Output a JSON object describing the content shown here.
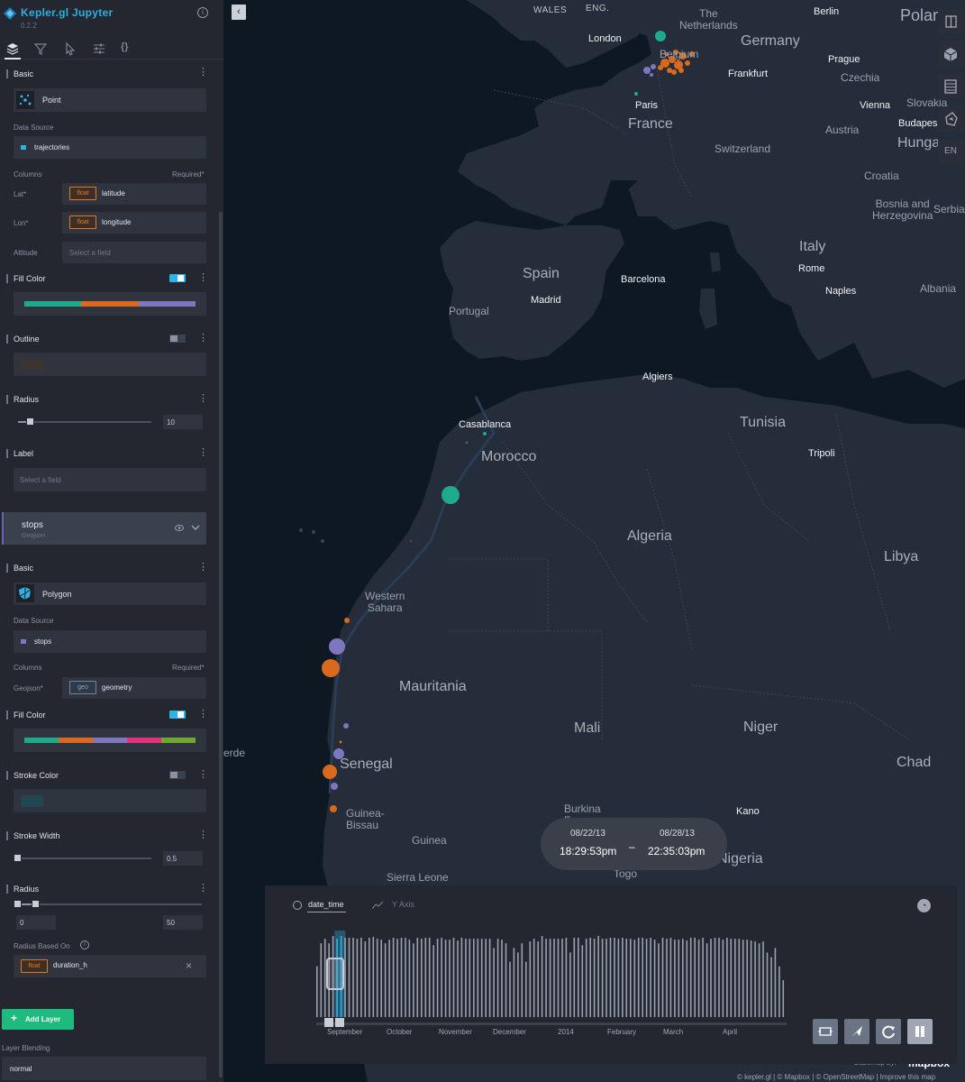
{
  "app": {
    "title": "Kepler.gl Jupyter",
    "version": "0.2.2"
  },
  "sidebar": {
    "tabs": [
      "layers-icon",
      "filter-icon",
      "interaction-icon",
      "settings-icon",
      "code-icon"
    ],
    "layer1": {
      "basic_label": "Basic",
      "type": "Point",
      "data_source_label": "Data Source",
      "data_source": "trajectories",
      "data_source_color": "#2fb3e5",
      "columns_label": "Columns",
      "required_label": "Required*",
      "lat_label": "Lat*",
      "lat_type": "float",
      "lat_field": "latitude",
      "lon_label": "Lon*",
      "lon_type": "float",
      "lon_field": "longitude",
      "alt_label": "Altitude",
      "alt_placeholder": "Select a field",
      "fill_color_label": "Fill Color",
      "fill_palette": [
        "#1fa98d",
        "#d8691f",
        "#7f76bf"
      ],
      "outline_label": "Outline",
      "outline_color": "#3c3430",
      "radius_label": "Radius",
      "radius_value": "10",
      "label_label": "Label",
      "label_placeholder": "Select a field"
    },
    "layer2": {
      "name": "stops",
      "layer_type": "Geojson",
      "basic_label": "Basic",
      "type": "Polygon",
      "data_source_label": "Data Source",
      "data_source": "stops",
      "data_source_color": "#7f76bf",
      "columns_label": "Columns",
      "required_label": "Required*",
      "geojson_label": "Geojson*",
      "geojson_type": "geo",
      "geojson_field": "geometry",
      "fill_color_label": "Fill Color",
      "fill_palette": [
        "#1fa98d",
        "#d8691f",
        "#7f76bf",
        "#e0327a",
        "#6fa731"
      ],
      "stroke_color_label": "Stroke Color",
      "stroke_color": "#20464f",
      "stroke_width_label": "Stroke Width",
      "stroke_width_value": "0.5",
      "radius_label": "Radius",
      "radius_min": "0",
      "radius_max": "50",
      "radius_based_on_label": "Radius Based On",
      "radius_based_type": "float",
      "radius_based_field": "duration_h"
    },
    "add_layer_label": "Add Layer",
    "layer_blending_label": "Layer Blending",
    "layer_blending_value": "normal"
  },
  "map": {
    "labels": {
      "wales": "WALES",
      "eng": "ENG.",
      "the_netherlands": "The\nNetherlands",
      "berlin": "Berlin",
      "poland": "Polan",
      "london": "London",
      "germany": "Germany",
      "belgium": "Belgium",
      "prague": "Prague",
      "frankfurt": "Frankfurt",
      "czechia": "Czechia",
      "paris": "Paris",
      "vienna": "Vienna",
      "slovakia": "Slovakia",
      "france": "France",
      "austria": "Austria",
      "budapest": "Budapes",
      "hungary": "Hunga",
      "switzerland": "Switzerland",
      "croatia": "Croatia",
      "bosnia": "Bosnia and\nHerzegovina",
      "serbia": "Serbia",
      "italy": "Italy",
      "spain": "Spain",
      "barcelona": "Barcelona",
      "rome": "Rome",
      "madrid": "Madrid",
      "naples": "Naples",
      "albania": "Albania",
      "portugal": "Portugal",
      "algiers": "Algiers",
      "casablanca": "Casablanca",
      "tunisia": "Tunisia",
      "tripoli": "Tripoli",
      "morocco": "Morocco",
      "algeria": "Algeria",
      "libya": "Libya",
      "western_sahara": "Western\nSahara",
      "mauritania": "Mauritania",
      "mali": "Mali",
      "niger": "Niger",
      "verde": "erde",
      "senegal": "Senegal",
      "chad": "Chad",
      "burkina": "Burkina\nFaso",
      "kano": "Kano",
      "guinea_bissau": "Guinea-\nBissau",
      "guinea": "Guinea",
      "nigeria": "Nigeria",
      "sierra_leone": "Sierra Leone",
      "togo": "Togo"
    },
    "controls": [
      "split-map-icon",
      "3d-map-icon",
      "legend-icon",
      "draw-polygon-icon"
    ],
    "locale": "EN",
    "attribution_basemap": "Basemap by:",
    "attribution_brand": "mapbox",
    "attribution": "© kepler.gl | © Mapbox | © OpenStreetMap | Improve this map",
    "point_colors": {
      "green": "#1fa98d",
      "orange": "#d8691f",
      "purple": "#7f76bf"
    }
  },
  "time_popup": {
    "start_date": "08/22/13",
    "start_time": "18:29:53pm",
    "end_date": "08/28/13",
    "end_time": "22:35:03pm",
    "separator": "–"
  },
  "timeline": {
    "field": "date_time",
    "y_axis_label": "Y Axis",
    "speed_icon": "speed-icon",
    "months": [
      "September",
      "October",
      "November",
      "December",
      "2014",
      "February",
      "March",
      "April"
    ],
    "histogram_counts": [
      55,
      80,
      85,
      80,
      88,
      85,
      88,
      86,
      86,
      86,
      85,
      86,
      82,
      86,
      87,
      85,
      84,
      80,
      84,
      86,
      85,
      86,
      86,
      84,
      80,
      86,
      85,
      86,
      86,
      78,
      85,
      86,
      84,
      84,
      86,
      83,
      86,
      85,
      85,
      85,
      85,
      85,
      85,
      85,
      75,
      85,
      84,
      80,
      60,
      75,
      70,
      80,
      60,
      82,
      85,
      82,
      88,
      85,
      85,
      85,
      85,
      85,
      86,
      70,
      86,
      86,
      78,
      85,
      86,
      85,
      88,
      85,
      85,
      86,
      86,
      85,
      86,
      85,
      85,
      84,
      86,
      86,
      85,
      86,
      84,
      80,
      86,
      85,
      86,
      84,
      84,
      85,
      83,
      86,
      86,
      84,
      86,
      80,
      85,
      86,
      86,
      84,
      86,
      85,
      85,
      85,
      84,
      84,
      83,
      82,
      80,
      82,
      70,
      65,
      75,
      55,
      40
    ],
    "selection_start_index": 5,
    "selection_end_index": 6,
    "buttons": [
      "reset-window-icon",
      "speed-rocket-icon",
      "loop-icon",
      "pause-icon"
    ]
  }
}
